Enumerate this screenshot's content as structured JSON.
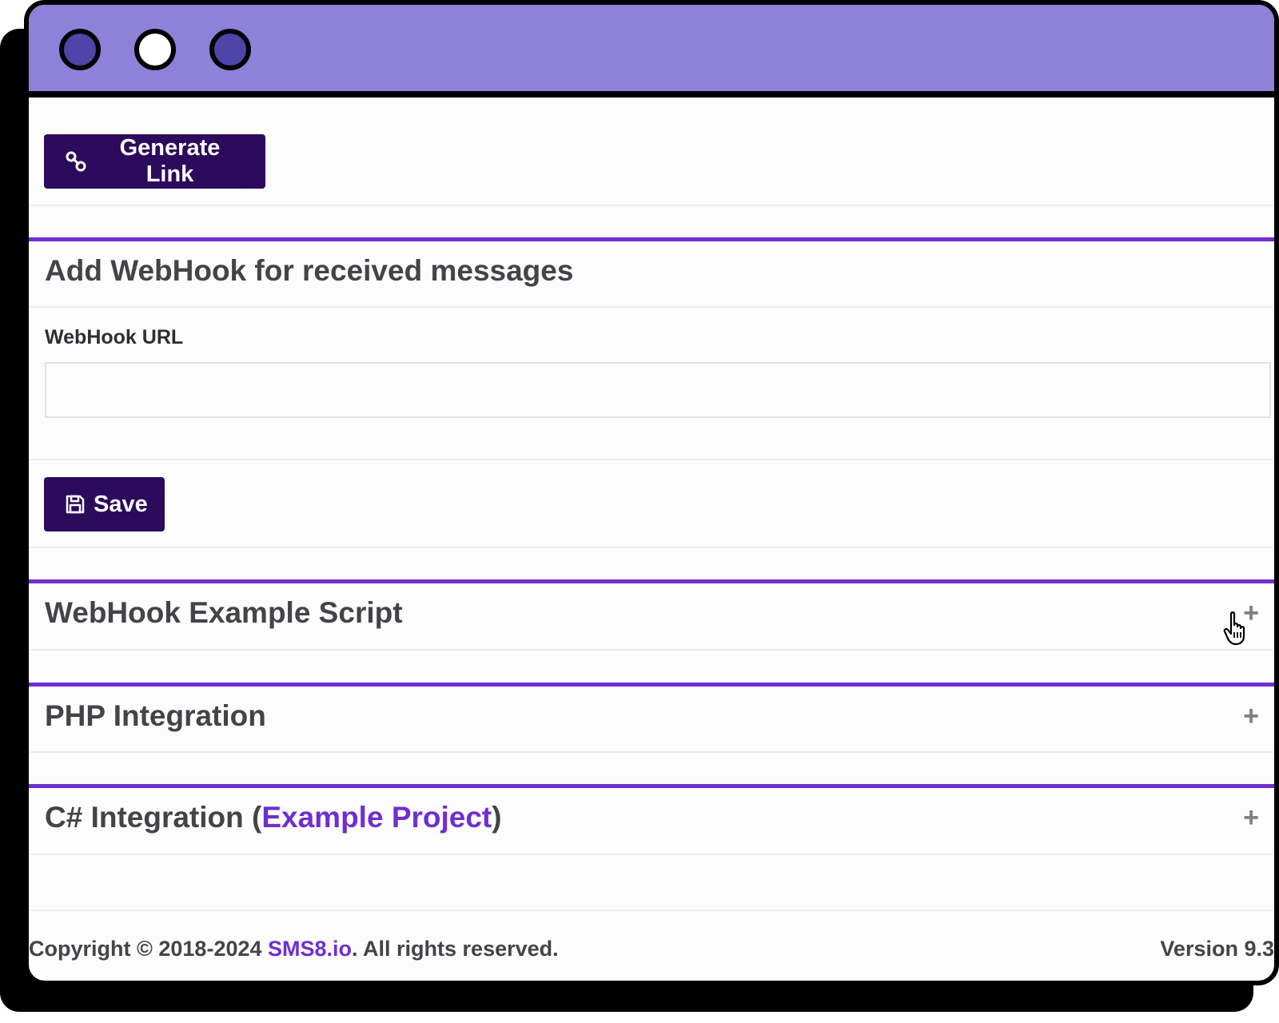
{
  "window": {
    "traffic_lights": [
      {
        "name": "close",
        "color": "#4f44a8"
      },
      {
        "name": "minimize",
        "color": "#ffffff"
      },
      {
        "name": "maximize",
        "color": "#4f44a8"
      }
    ],
    "titlebar_color": "#8d81d9"
  },
  "generate_link": {
    "label": "Generate Link",
    "icon": "link-icon"
  },
  "webhook_section": {
    "title": "Add WebHook for received messages",
    "url_label": "WebHook URL",
    "url_value": "",
    "url_placeholder": "",
    "save_label": "Save",
    "save_icon": "floppy-disk-icon"
  },
  "accordion": [
    {
      "title": "WebHook Example Script",
      "toggle": "+"
    },
    {
      "title": "PHP Integration",
      "toggle": "+"
    },
    {
      "title_prefix": "C# Integration (",
      "title_link": "Example Project",
      "title_suffix": ")",
      "toggle": "+"
    }
  ],
  "footer": {
    "prefix": "Copyright © 2018-2024 ",
    "brand_link": "SMS8.io",
    "suffix": ". All rights reserved.",
    "version": "Version 9.3"
  },
  "colors": {
    "primary_button": "#2c0a5c",
    "accent": "#6f2fd0"
  }
}
